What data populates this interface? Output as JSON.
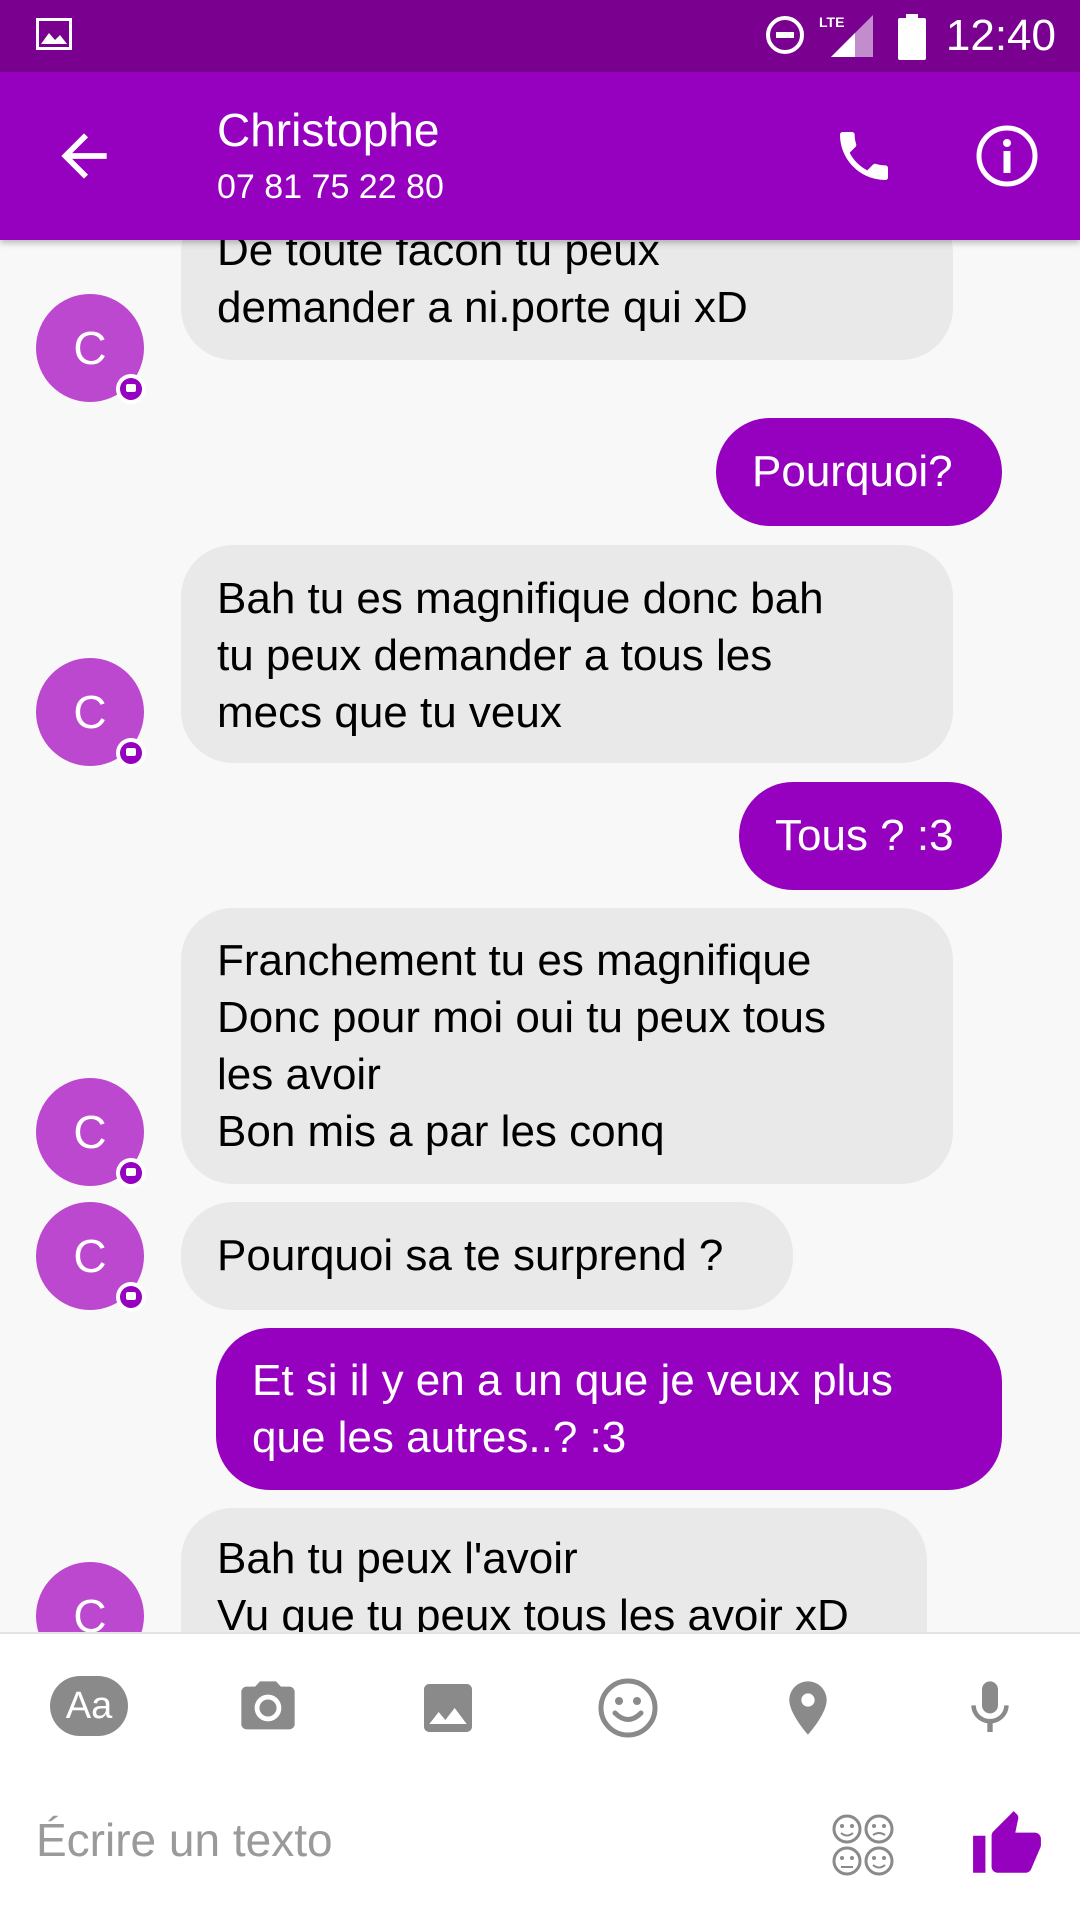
{
  "status_bar": {
    "time": "12:40",
    "network": "LTE"
  },
  "header": {
    "contact_name": "Christophe",
    "phone": "07 81 75 22 80",
    "back_icon": "arrow-left-icon",
    "call_icon": "phone-icon",
    "info_icon": "info-icon"
  },
  "messages": [
    {
      "dir": "in",
      "avatar": "C",
      "text": "De toute facon tu peux\ndemander a ni.porte qui xD"
    },
    {
      "dir": "out",
      "text": "Pourquoi?"
    },
    {
      "dir": "in",
      "avatar": "C",
      "text": "Bah tu es magnifique donc bah\ntu peux demander a tous les\nmecs que tu veux"
    },
    {
      "dir": "out",
      "text": "Tous ? :3"
    },
    {
      "dir": "in",
      "avatar": "C",
      "text": "Franchement tu es magnifique\nDonc pour moi oui tu peux tous\nles avoir\nBon mis a par les conq"
    },
    {
      "dir": "in",
      "avatar": "C",
      "text": "Pourquoi sa te surprend ?"
    },
    {
      "dir": "out",
      "text": "Et si il y en a un que je veux plus\nque les autres..? :3"
    },
    {
      "dir": "in",
      "avatar": "C",
      "text": "Bah tu peux l'avoir\nVu que tu peux tous les avoir xD"
    }
  ],
  "composer": {
    "placeholder": "Écrire un texto",
    "tools": [
      "text-format-icon",
      "camera-icon",
      "image-icon",
      "emoji-icon",
      "location-icon",
      "microphone-icon"
    ],
    "format_label": "Aa",
    "send_icon": "thumbs-up-icon"
  },
  "colors": {
    "status_bar": "#7a0090",
    "app_bar": "#9600bf",
    "outgoing_bubble": "#9600bf",
    "incoming_bubble": "#e9e9e9",
    "avatar": "#bb48cf"
  }
}
